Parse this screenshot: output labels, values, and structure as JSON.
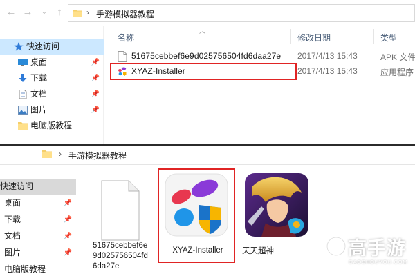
{
  "top": {
    "address": {
      "path": "手游模拟器教程",
      "separator": "›"
    },
    "nav": {
      "back": "←",
      "forward": "→"
    },
    "sidebar": {
      "items": [
        {
          "label": "快速访问",
          "icon": "star-icon",
          "selected": true
        },
        {
          "label": "桌面",
          "icon": "desktop-icon",
          "pinned": true
        },
        {
          "label": "下载",
          "icon": "download-icon",
          "pinned": true
        },
        {
          "label": "文档",
          "icon": "document-icon",
          "pinned": true
        },
        {
          "label": "图片",
          "icon": "picture-icon",
          "pinned": true
        },
        {
          "label": "电脑版教程",
          "icon": "folder-icon"
        }
      ]
    },
    "columns": {
      "name": "名称",
      "date": "修改日期",
      "type": "类型"
    },
    "files": [
      {
        "name": "51675cebbef6e9d025756504fd6daa27e",
        "date": "2017/4/13 15:43",
        "type": "APK 文件",
        "icon": "file-icon"
      },
      {
        "name": "XYAZ-Installer",
        "date": "2017/4/13 15:43",
        "type": "应用程序",
        "icon": "xyaz-app-icon"
      }
    ]
  },
  "bottom": {
    "address": {
      "path": "手游模拟器教程",
      "separator": "›"
    },
    "sidebar": {
      "items": [
        {
          "label": "快速访问",
          "selected": true
        },
        {
          "label": "桌面",
          "pinned": true
        },
        {
          "label": "下载",
          "pinned": true
        },
        {
          "label": "文档",
          "pinned": true
        },
        {
          "label": "图片",
          "pinned": true
        },
        {
          "label": "电脑版教程"
        }
      ]
    },
    "tiles": [
      {
        "label_lines": [
          "51675cebbef6e",
          "9d025756504fd",
          "6da27e"
        ],
        "icon": "blank-file-icon"
      },
      {
        "label_lines": [
          "XYAZ-Installer"
        ],
        "icon": "xyaz-installer-icon"
      },
      {
        "label_lines": [
          "天天超神"
        ],
        "icon": "game-tiantian-icon"
      }
    ],
    "watermark": {
      "brand": "高手游",
      "domain": "GAOSHOUYOU.COM"
    }
  },
  "colors": {
    "highlight": "#e02424",
    "selection": "#cce8ff",
    "folder": "#f5cf6b",
    "header_text": "#4c607a"
  }
}
